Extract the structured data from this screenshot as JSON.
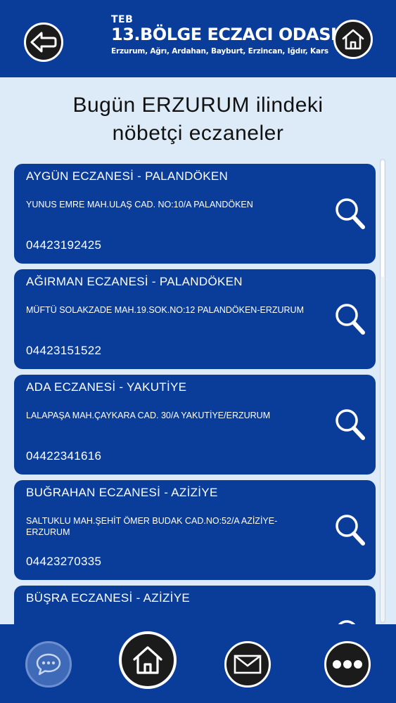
{
  "header": {
    "teb": "TEB",
    "org": "13.BÖLGE ECZACI ODASI",
    "cities": "Erzurum, Ağrı, Ardahan, Bayburt, Erzincan, Iğdır, Kars"
  },
  "title": {
    "line1": "Bugün ERZURUM ilindeki",
    "line2": "nöbetçi eczaneler"
  },
  "pharmacies": [
    {
      "name": "AYGÜN  ECZANESİ - PALANDÖKEN",
      "address": "YUNUS EMRE MAH.ULAŞ CAD. NO:10/A PALANDÖKEN",
      "phone": "04423192425"
    },
    {
      "name": "AĞIRMAN ECZANESİ - PALANDÖKEN",
      "address": "MÜFTÜ SOLAKZADE MAH.19.SOK.NO:12 PALANDÖKEN-ERZURUM",
      "phone": "04423151522"
    },
    {
      "name": "ADA  ECZANESİ - YAKUTİYE",
      "address": "LALAPAŞA MAH.ÇAYKARA CAD. 30/A YAKUTİYE/ERZURUM",
      "phone": "04422341616"
    },
    {
      "name": "BUĞRAHAN ECZANESİ - AZİZİYE",
      "address": "SALTUKLU MAH.ŞEHİT ÖMER BUDAK CAD.NO:52/A AZİZİYE-ERZURUM",
      "phone": "04423270335"
    },
    {
      "name": "BÜŞRA ECZANESİ - AZİZİYE",
      "address": "",
      "phone": ""
    }
  ],
  "icons": {
    "back": "back-arrow-icon",
    "home": "home-icon",
    "search": "search-icon",
    "chat": "chat-icon",
    "mail": "mail-icon",
    "more": "more-icon"
  },
  "colors": {
    "primary": "#0a3d9a",
    "background": "#dcebf7",
    "button": "#1b1b1b"
  }
}
